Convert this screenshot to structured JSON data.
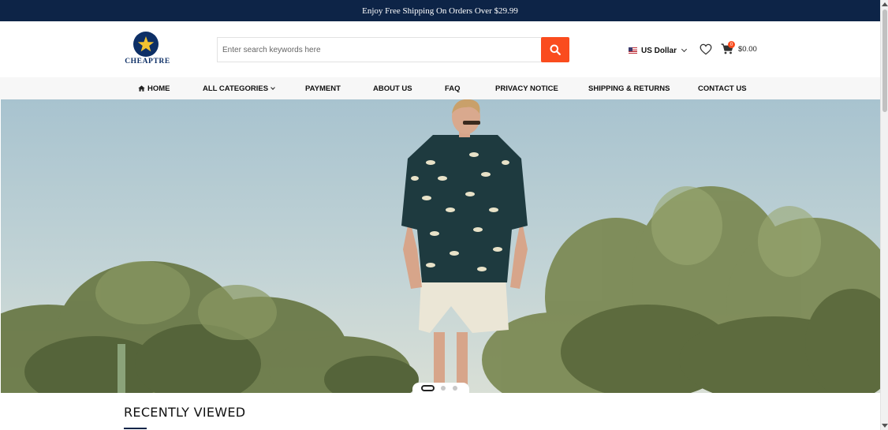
{
  "announcement": {
    "text": "Enjoy Free Shipping On Orders Over $29.99"
  },
  "logo": {
    "text": "CHEAPTRE"
  },
  "search": {
    "placeholder": "Enter search keywords here"
  },
  "currency": {
    "label": "US Dollar",
    "flag": "us-flag-icon"
  },
  "cart": {
    "count": "0",
    "total": "$0.00"
  },
  "nav": {
    "home": "HOME",
    "all_categories": "ALL CATEGORIES",
    "payment": "PAYMENT",
    "about_us": "ABOUT US",
    "faq": "FAQ",
    "privacy_notice": "PRIVACY NOTICE",
    "shipping_returns": "SHIPPING & RETURNS",
    "contact_us": "CONTACT US"
  },
  "slider": {
    "slide_count": 3,
    "active_index": 0
  },
  "recently_viewed": {
    "title": "RECENTLY VIEWED"
  },
  "colors": {
    "topbar": "#0d2447",
    "accent": "#fa4c1e",
    "nav_bg": "#f7f7f7",
    "logo": "#0d2f66"
  }
}
